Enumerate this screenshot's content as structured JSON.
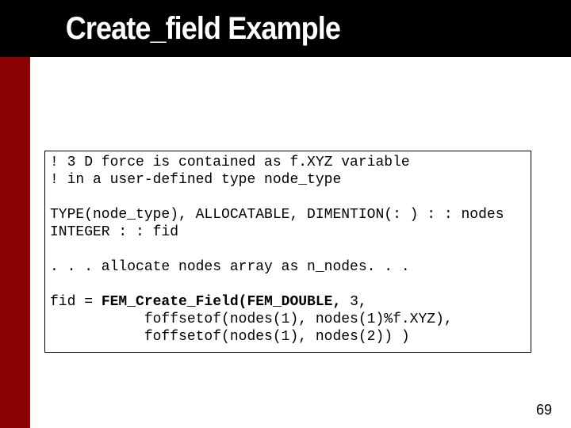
{
  "title": "Create_field Example",
  "code": {
    "c1": "! 3 D force is contained as f.XYZ variable",
    "c2": "! in a user-defined type node_type",
    "blank1": "",
    "c3": "TYPE(node_type), ALLOCATABLE, DIMENTION(: ) : : nodes",
    "c4": "INTEGER : : fid",
    "blank2": "",
    "c5": ". . . allocate nodes array as n_nodes. . .",
    "blank3": "",
    "c6a": "fid = ",
    "c6b": "FEM_Create_Field(FEM_DOUBLE,",
    "c6c": " 3,",
    "c7": "           foffsetof(nodes(1), nodes(1)%f.XYZ),",
    "c8": "           foffsetof(nodes(1), nodes(2)) )"
  },
  "page_number": "69"
}
